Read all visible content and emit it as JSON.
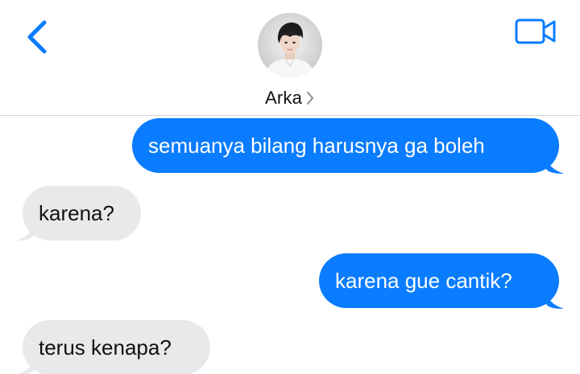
{
  "header": {
    "contact_name": "Arka",
    "avatar_alt": "Contact photo",
    "icons": {
      "back": "chevron-left-icon",
      "video": "video-camera-icon",
      "disclosure": "chevron-right-icon"
    },
    "accent_color": "#0a7cff"
  },
  "messages": [
    {
      "direction": "outgoing",
      "text": "semuanya bilang harusnya ga boleh"
    },
    {
      "direction": "incoming",
      "text": "karena?"
    },
    {
      "direction": "outgoing",
      "text": "karena gue cantik?"
    },
    {
      "direction": "incoming",
      "text": "terus kenapa?"
    }
  ],
  "colors": {
    "outgoing_bubble": "#0a7cff",
    "incoming_bubble": "#e9e9eb",
    "outgoing_text": "#ffffff",
    "incoming_text": "#111111"
  }
}
